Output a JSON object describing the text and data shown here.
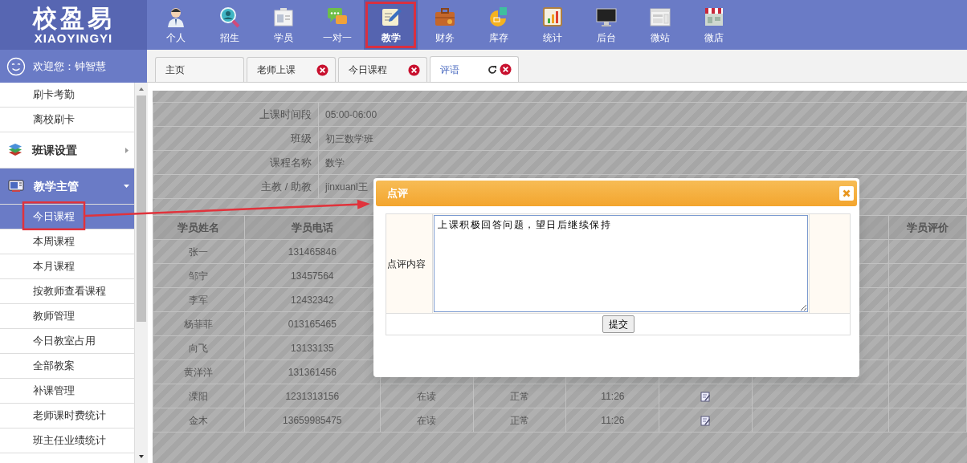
{
  "logo": {
    "title": "校盈易",
    "subtitle": "XIAOYINGYI"
  },
  "nav": [
    {
      "label": "个人",
      "selected": false
    },
    {
      "label": "招生",
      "selected": false
    },
    {
      "label": "学员",
      "selected": false
    },
    {
      "label": "一对一",
      "selected": false
    },
    {
      "label": "教学",
      "selected": true
    },
    {
      "label": "财务",
      "selected": false
    },
    {
      "label": "库存",
      "selected": false
    },
    {
      "label": "统计",
      "selected": false
    },
    {
      "label": "后台",
      "selected": false
    },
    {
      "label": "微站",
      "selected": false
    },
    {
      "label": "微店",
      "selected": false
    }
  ],
  "welcome": "欢迎您：钟智慧",
  "tabs": [
    {
      "label": "主页",
      "selected": false,
      "closable": false,
      "refresh": false
    },
    {
      "label": "老师上课",
      "selected": false,
      "closable": true,
      "refresh": false
    },
    {
      "label": "今日课程",
      "selected": false,
      "closable": true,
      "refresh": false
    },
    {
      "label": "评语",
      "selected": true,
      "closable": true,
      "refresh": true
    }
  ],
  "sidebar": {
    "items": [
      {
        "kind": "link",
        "label": "刷卡考勤",
        "selected": false
      },
      {
        "kind": "link",
        "label": "离校刷卡",
        "selected": false
      },
      {
        "kind": "group",
        "label": "班课设置",
        "expanded": false
      },
      {
        "kind": "group",
        "label": "教学主管",
        "expanded": true,
        "children": [
          {
            "kind": "link",
            "label": "今日课程",
            "selected": true
          },
          {
            "kind": "link",
            "label": "本周课程",
            "selected": false
          },
          {
            "kind": "link",
            "label": "本月课程",
            "selected": false
          },
          {
            "kind": "link",
            "label": "按教师查看课程",
            "selected": false
          },
          {
            "kind": "link",
            "label": "教师管理",
            "selected": false
          },
          {
            "kind": "link",
            "label": "今日教室占用",
            "selected": false
          },
          {
            "kind": "link",
            "label": "全部教案",
            "selected": false
          },
          {
            "kind": "link",
            "label": "补课管理",
            "selected": false
          },
          {
            "kind": "link",
            "label": "老师课时费统计",
            "selected": false
          },
          {
            "kind": "link",
            "label": "班主任业绩统计",
            "selected": false
          }
        ]
      }
    ]
  },
  "lesson_info": [
    {
      "label": "上课时间段",
      "value": "05:00-06:00"
    },
    {
      "label": "班级",
      "value": "初三数学班"
    },
    {
      "label": "课程名称",
      "value": "数学"
    },
    {
      "label": "主教 / 助教",
      "value": "jinxuanl王"
    }
  ],
  "students": {
    "columns": [
      "学员姓名",
      "学员电话"
    ],
    "last_column": "学员评价",
    "rows": [
      {
        "cells": [
          "张一",
          "131465846"
        ]
      },
      {
        "cells": [
          "邹宁",
          "13457564"
        ]
      },
      {
        "cells": [
          "李军",
          "12432342"
        ]
      },
      {
        "cells": [
          "杨菲菲",
          "013165465"
        ]
      },
      {
        "cells": [
          "向飞",
          "13133135"
        ]
      },
      {
        "cells": [
          "黄洋洋",
          "131361456"
        ]
      },
      {
        "cells": [
          "溧阳",
          "1231313156",
          "在读",
          "正常",
          "11:26"
        ],
        "edit": true
      },
      {
        "cells": [
          "金木",
          "13659985475",
          "在读",
          "正常",
          "11:26"
        ],
        "edit": true
      }
    ]
  },
  "dialog": {
    "title": "点评",
    "field_label": "点评内容",
    "value": "上课积极回答问题，望日后继续保持",
    "submit": "提交"
  }
}
